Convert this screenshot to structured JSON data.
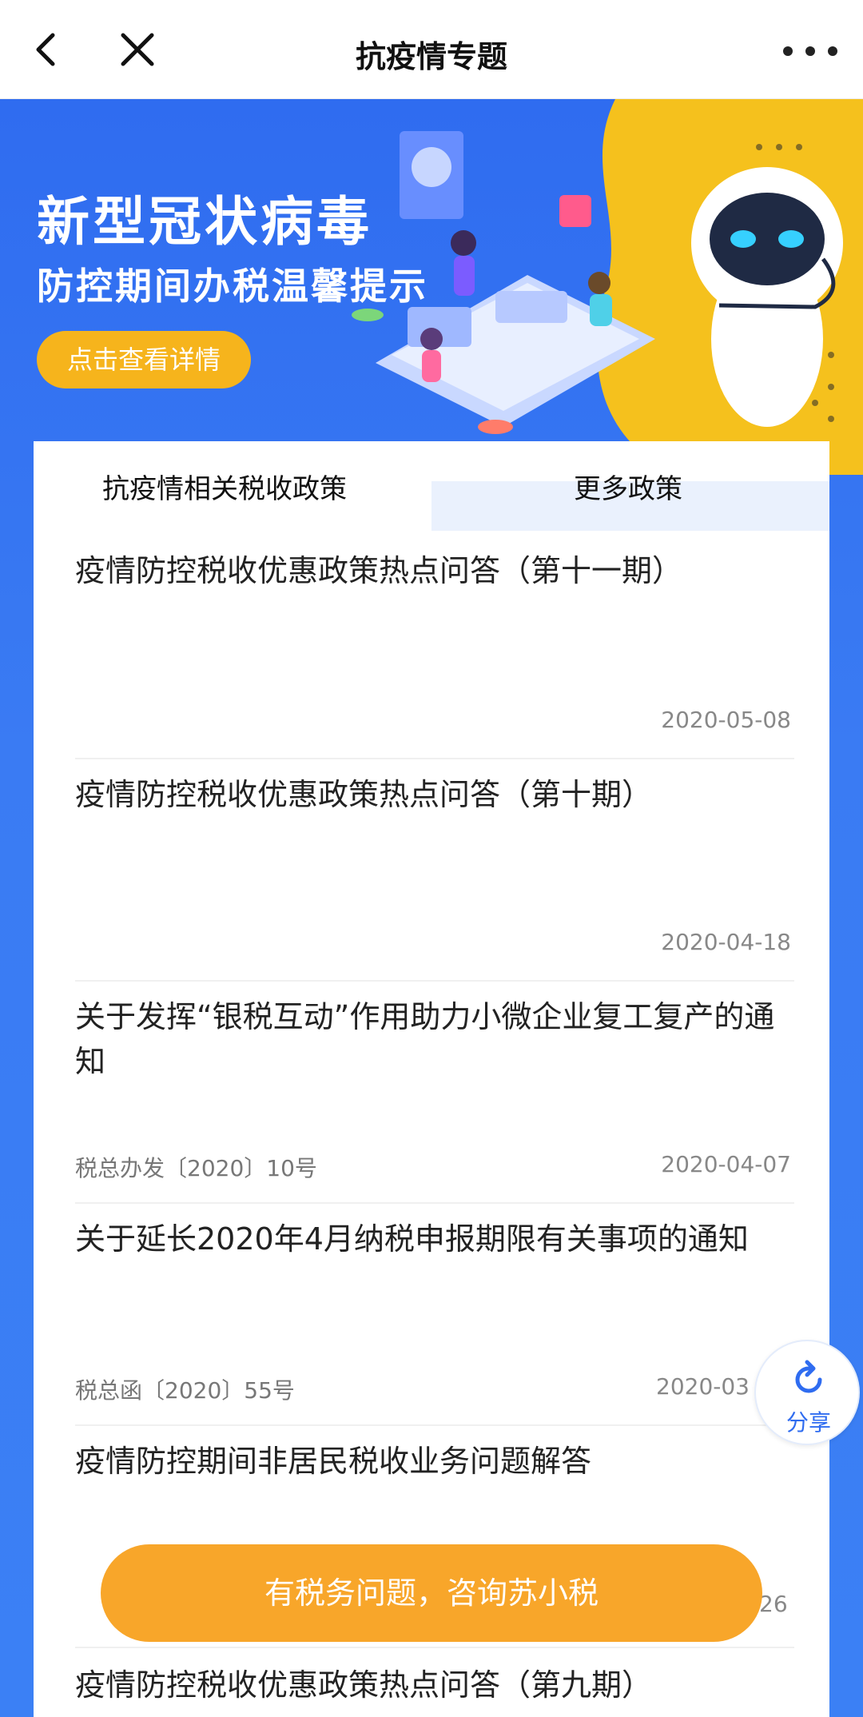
{
  "nav": {
    "title": "抗疫情专题"
  },
  "banner": {
    "title": "新型冠状病毒",
    "subtitle": "防控期间办税温馨提示",
    "button_label": "点击查看详情"
  },
  "tabs": [
    {
      "label": "抗疫情相关税收政策",
      "active": true
    },
    {
      "label": "更多政策",
      "active": false
    }
  ],
  "items": [
    {
      "title": "疫情防控税收优惠政策热点问答（第十一期）",
      "doc": "",
      "date": "2020-05-08"
    },
    {
      "title": "疫情防控税收优惠政策热点问答（第十期）",
      "doc": "",
      "date": "2020-04-18"
    },
    {
      "title": "关于发挥“银税互动”作用助力小微企业复工复产的通知",
      "doc": "税总办发〔2020〕10号",
      "date": "2020-04-07"
    },
    {
      "title": "关于延长2020年4月纳税申报期限有关事项的通知",
      "doc": "税总函〔2020〕55号",
      "date": "2020-03"
    },
    {
      "title": "疫情防控期间非居民税收业务问题解答",
      "doc": "",
      "date": ""
    },
    {
      "title": "疫情防控税收优惠政策热点问答（第九期）",
      "doc": "",
      "date": ""
    }
  ],
  "share": {
    "label": "分享"
  },
  "consult": {
    "label": "有税务问题，咨询苏小税",
    "covered_date_fragment": "26"
  },
  "colors": {
    "brand_blue": "#2f6cf0",
    "accent_orange": "#f8a62a",
    "banner_button_yellow": "#f6b41c"
  }
}
